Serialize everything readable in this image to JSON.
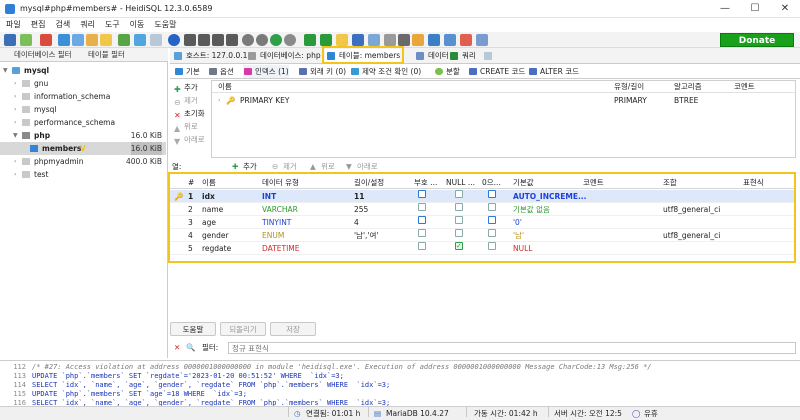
{
  "window": {
    "title": "mysql#php#members# - HeidiSQL 12.3.0.6589",
    "controls": {
      "minimize": "—",
      "maximize": "☐",
      "close": "✕"
    }
  },
  "menu": [
    "파일",
    "편집",
    "검색",
    "쿼리",
    "도구",
    "이동",
    "도움말"
  ],
  "toolbar": {
    "donate_label": "Donate"
  },
  "left_tabs": {
    "db_filter": "데이터베이스 필터",
    "table_filter": "테이블 필터"
  },
  "tree": {
    "root": "mysql",
    "items": [
      {
        "label": "gnu",
        "size": ""
      },
      {
        "label": "information_schema",
        "size": ""
      },
      {
        "label": "mysql",
        "size": ""
      },
      {
        "label": "performance_schema",
        "size": ""
      },
      {
        "label": "php",
        "size": "16.0 KiB"
      },
      {
        "label": "members",
        "size": "16.0 KiB"
      },
      {
        "label": "phpmyadmin",
        "size": "400.0 KiB"
      },
      {
        "label": "test",
        "size": ""
      }
    ]
  },
  "main_tabs": {
    "host": "호스트: 127.0.0.1",
    "database": "데이터베이스: php",
    "table": "테이블: members",
    "data": "데이터",
    "query": "쿼리"
  },
  "sub_tabs": {
    "basic": "기본",
    "options": "옵션",
    "indexes": "인덱스 (1)",
    "foreign_keys": "외래 키 (0)",
    "check_constraints": "제약 조건 확인 (0)",
    "partitions": "분할",
    "create_code": "CREATE 코드",
    "alter_code": "ALTER 코드"
  },
  "index_buttons": {
    "add": "추가",
    "remove": "제거",
    "clear": "초기화",
    "up": "위로",
    "down": "아래로"
  },
  "index_table": {
    "headers": {
      "name": "이름",
      "type_length": "유형/길이",
      "algorithm": "알고리즘",
      "comment": "코멘트"
    },
    "rows": [
      {
        "name": "PRIMARY KEY",
        "type": "PRIMARY",
        "algorithm": "BTREE"
      }
    ]
  },
  "fields_bar": {
    "label": "열:",
    "add": "추가",
    "remove": "제거",
    "up": "위로",
    "down": "아래로"
  },
  "columns_table": {
    "headers": {
      "num": "#",
      "name": "이름",
      "datatype": "데이터 유형",
      "length": "길이/설정",
      "unsigned": "부호 ...",
      "allow_null": "NULL ...",
      "zerofill": "0으...",
      "default": "기본값",
      "comment": "코멘트",
      "collation": "조합",
      "expression": "표현식"
    },
    "rows": [
      {
        "num": "1",
        "name": "idx",
        "datatype": "INT",
        "length": "11",
        "default": "AUTO_INCREME...",
        "collation": "",
        "null_checked": false
      },
      {
        "num": "2",
        "name": "name",
        "datatype": "VARCHAR",
        "length": "255",
        "default": "기본값 없음",
        "collation": "utf8_general_ci",
        "null_checked": false
      },
      {
        "num": "3",
        "name": "age",
        "datatype": "TINYINT",
        "length": "4",
        "default": "'0'",
        "collation": "",
        "null_checked": false
      },
      {
        "num": "4",
        "name": "gender",
        "datatype": "ENUM",
        "length": "'남','여'",
        "default": "'남'",
        "collation": "utf8_general_ci",
        "null_checked": false
      },
      {
        "num": "5",
        "name": "regdate",
        "datatype": "DATETIME",
        "length": "",
        "default": "NULL",
        "collation": "",
        "null_checked": true
      }
    ],
    "colors": {
      "int": "#1f3fd6",
      "varchar": "#2e9a2e",
      "enum": "#b5911f",
      "datetime": "#d12a2a",
      "selected_row": "#dde9fb"
    }
  },
  "bottom_buttons": {
    "help": "도움말",
    "discard": "되돌리기",
    "save": "저장"
  },
  "filter": {
    "label": "필터:",
    "placeholder": "정규 표현식"
  },
  "log": [
    {
      "n": "112",
      "text": "/* #27: Access violation at address 0000001000000000 in module 'heidisql.exe'. Execution of address 0000001000000000 Message CharCode:13 Msg:256 */",
      "comment": true
    },
    {
      "n": "113",
      "text": "UPDATE `php`.`members` SET `regdate`='2023-01-20 00:51:52' WHERE  `idx`=3;",
      "comment": false
    },
    {
      "n": "114",
      "text": "SELECT `idx`, `name`, `age`, `gender`, `regdate` FROM `php`.`members` WHERE  `idx`=3;",
      "comment": false
    },
    {
      "n": "115",
      "text": "UPDATE `php`.`members` SET `age`=18 WHERE  `idx`=3;",
      "comment": false
    },
    {
      "n": "116",
      "text": "SELECT `idx`, `name`, `age`, `gender`, `regdate` FROM `php`.`members` WHERE  `idx`=3;",
      "comment": false
    }
  ],
  "status": {
    "connected": "연결됨: 01:01 h",
    "server": "MariaDB 10.4.27",
    "uptime": "가동 시간: 01:42 h",
    "server_time": "서버 시간: 오전 12:5",
    "idle": "유휴"
  }
}
